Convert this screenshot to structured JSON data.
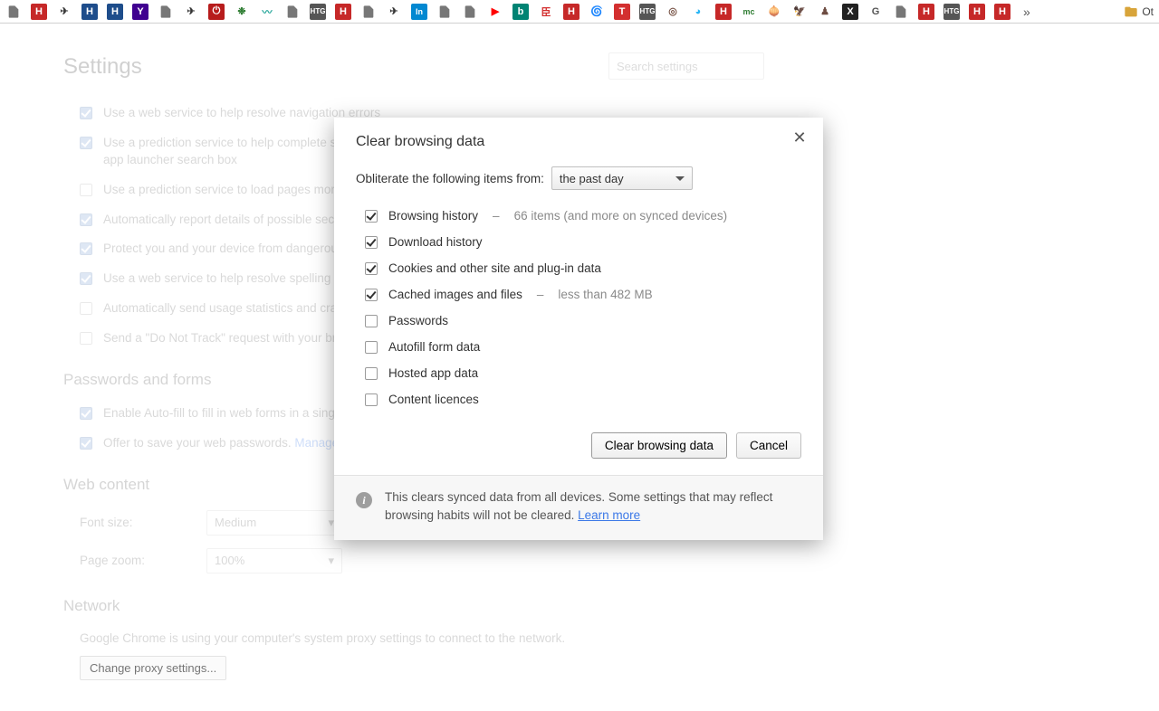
{
  "bookmarks_overflow": "»",
  "bookmarks_folder_label": "Ot",
  "settings": {
    "title": "Settings",
    "search_placeholder": "Search settings",
    "privacy_opts": [
      {
        "checked": true,
        "label": "Use a web service to help resolve navigation errors"
      },
      {
        "checked": true,
        "label": "Use a prediction service to help complete searches and URLs typed in the address bar or the app launcher search box"
      },
      {
        "checked": false,
        "label": "Use a prediction service to load pages more quickly"
      },
      {
        "checked": true,
        "label": "Automatically report details of possible security incidents to Google"
      },
      {
        "checked": true,
        "label": "Protect you and your device from dangerous sites"
      },
      {
        "checked": true,
        "label": "Use a web service to help resolve spelling errors"
      },
      {
        "checked": false,
        "label": "Automatically send usage statistics and crash reports to Google"
      },
      {
        "checked": false,
        "label": "Send a \"Do Not Track\" request with your browsing traffic"
      }
    ],
    "pw_section": "Passwords and forms",
    "pw_opts": [
      {
        "checked": true,
        "label": "Enable Auto-fill to fill in web forms in a single click."
      },
      {
        "checked": true,
        "label": "Offer to save your web passwords.",
        "link": "Manage passwords"
      }
    ],
    "web_section": "Web content",
    "font_label": "Font size:",
    "font_value": "Medium",
    "zoom_label": "Page zoom:",
    "zoom_value": "100%",
    "net_section": "Network",
    "net_text": "Google Chrome is using your computer's system proxy settings to connect to the network.",
    "proxy_btn": "Change proxy settings..."
  },
  "dialog": {
    "title": "Clear browsing data",
    "obliterate_label": "Obliterate the following items from:",
    "range_value": "the past day",
    "items": [
      {
        "checked": true,
        "label": "Browsing history",
        "sub": "66 items (and more on synced devices)"
      },
      {
        "checked": true,
        "label": "Download history"
      },
      {
        "checked": true,
        "label": "Cookies and other site and plug-in data"
      },
      {
        "checked": true,
        "label": "Cached images and files",
        "sub": "less than 482 MB"
      },
      {
        "checked": false,
        "label": "Passwords"
      },
      {
        "checked": false,
        "label": "Autofill form data"
      },
      {
        "checked": false,
        "label": "Hosted app data"
      },
      {
        "checked": false,
        "label": "Content licences"
      }
    ],
    "clear_btn": "Clear browsing data",
    "cancel_btn": "Cancel",
    "footer_text": "This clears synced data from all devices. Some settings that may reflect browsing habits will not be cleared. ",
    "learn_more": "Learn more"
  }
}
